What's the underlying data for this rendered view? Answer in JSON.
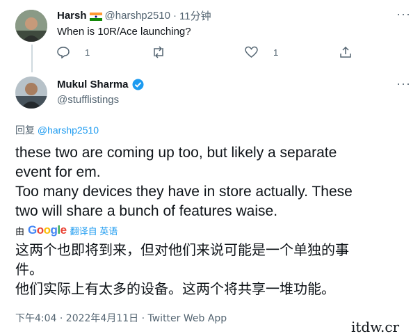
{
  "reply_tweet": {
    "name": "Harsh",
    "handle": "@harshp2510",
    "time": "11分钟",
    "text": "When is 10R/Ace launching?",
    "reply_count": "1",
    "like_count": "1"
  },
  "main_tweet": {
    "name": "Mukul Sharma",
    "handle": "@stufflistings",
    "replying_prefix": "回复",
    "replying_to": "@harshp2510",
    "text_lines": [
      "these two are coming up too, but likely a separate",
      "event for em.",
      "Too many devices they have in store actually. These",
      "two will share a bunch of features waise."
    ],
    "translated_by": "由",
    "google": "Google",
    "translate_label": "翻译自 英语",
    "translation_lines": [
      "这两个也即将到来，但对他们来说可能是一个单独的事",
      "件。",
      "他们实际上有太多的设备。这两个将共享一堆功能。"
    ],
    "timestamp": "下午4:04 · 2022年4月11日 · Twitter Web App"
  },
  "watermark": "itdw.cr",
  "icons": {
    "reply": "reply-icon",
    "retweet": "retweet-icon",
    "like": "heart-icon",
    "share": "share-icon",
    "more": "more-icon",
    "verified": "verified-badge-icon",
    "flag": "india-flag-icon"
  },
  "colors": {
    "link": "#1d9bf0",
    "muted": "#536471",
    "text": "#0f1419"
  }
}
